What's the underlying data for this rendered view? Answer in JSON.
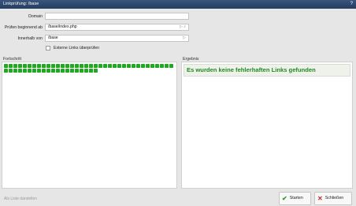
{
  "window": {
    "title": "Linkprüfung: /base",
    "help_icon": "?"
  },
  "form": {
    "domain_label": "Domain",
    "domain_value": "",
    "start_label": "Prüfen beginnend ab",
    "start_value": "/base/index.php",
    "within_label": "Innerhalb von",
    "within_value": "/base",
    "external_links_label": "Externe Links überprüfen",
    "external_links_checked": false
  },
  "progress": {
    "label": "Fortschritt",
    "completed_blocks": 56
  },
  "result": {
    "label": "Ergebnis",
    "message": "Es wurden keine fehlerhaften Links gefunden"
  },
  "footer": {
    "show_as_list": "Als Liste darstellen",
    "start_button": "Starten",
    "close_button": "Schließen"
  },
  "icons": {
    "field_select": "select-arrow-icon",
    "field_search": "search-icon",
    "start": "checkmark-icon",
    "close": "close-icon"
  },
  "colors": {
    "titlebar": "#2f4b74",
    "progress_block": "#1fa91f",
    "result_text": "#1d8a1d",
    "checkmark": "#2d9b2d",
    "close": "#c62a2a"
  }
}
